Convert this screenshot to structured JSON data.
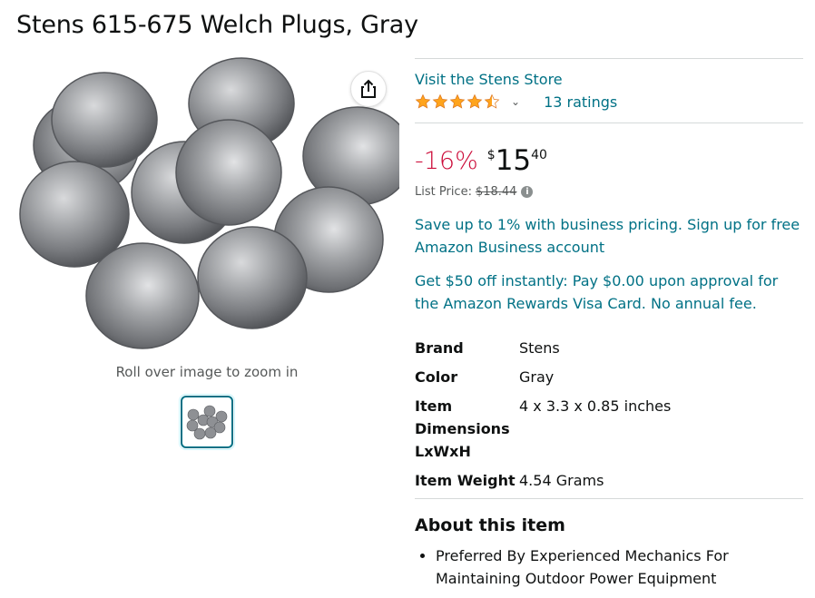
{
  "product": {
    "title": "Stens 615-675 Welch Plugs, Gray"
  },
  "gallery": {
    "zoom_hint": "Roll over image to zoom in",
    "main_image_icon": "welch-plugs-photo",
    "share_icon": "share-icon"
  },
  "store": {
    "link_text": "Visit the Stens Store"
  },
  "rating": {
    "stars": 4.5,
    "ratings_text": "13 ratings"
  },
  "price": {
    "discount": "-16%",
    "currency_symbol": "$",
    "whole": "15",
    "fraction": "40",
    "list_price_label": "List Price:",
    "list_price_value": "$18.44"
  },
  "promos": {
    "business": "Save up to 1% with business pricing. Sign up for free Amazon Business account",
    "rewards": "Get $50 off instantly: Pay $0.00 upon approval for the Amazon Rewards Visa Card. No annual fee."
  },
  "specs": [
    {
      "label": "Brand",
      "value": "Stens"
    },
    {
      "label": "Color",
      "value": "Gray"
    },
    {
      "label": "Item Dimensions LxWxH",
      "value": "4 x 3.3 x 0.85 inches"
    },
    {
      "label": "Item Weight",
      "value": "4.54 Grams"
    }
  ],
  "about": {
    "title": "About this item",
    "bullets": [
      "Preferred By Experienced Mechanics For Maintaining Outdoor Power Equipment"
    ]
  },
  "colors": {
    "link": "#007185",
    "discount": "#cc0c39",
    "star": "#ffa41c",
    "text": "#0f1111",
    "muted": "#565959"
  }
}
